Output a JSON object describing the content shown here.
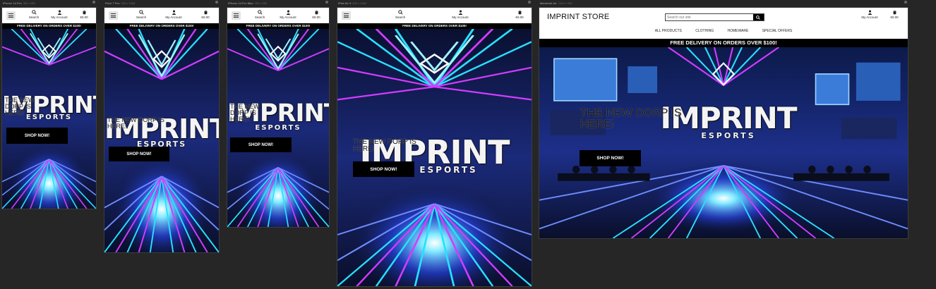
{
  "devices": [
    {
      "name": "iPhone 14 Pro",
      "dims": "390 x 852"
    },
    {
      "name": "Pixel 7 Pro",
      "dims": "430 x 1008"
    },
    {
      "name": "iPhone 14 Pro Max",
      "dims": "430 x 932"
    },
    {
      "name": "iPad Air 5",
      "dims": "820 x 1180"
    },
    {
      "name": "Macbook Air",
      "dims": "1440 x 900"
    }
  ],
  "store": {
    "brand": "IMPRINT STORE",
    "search_label": "Search",
    "search_placeholder": "Search our site",
    "account_label": "My Account",
    "cart_total": "€0.00",
    "delivery_banner": "FREE DELIVERY ON ORDERS OVER $100!",
    "nav": [
      "ALL PRODUCTS",
      "CLOTHING",
      "HOMEWARE",
      "SPECIAL OFFERS"
    ]
  },
  "hero": {
    "logo_main": "IMPRINT",
    "logo_sub": "ESPORTS",
    "tagline": "THE NEW DORP IS HERE!",
    "cta": "SHOP NOW!"
  },
  "colors": {
    "cyan": "#28e0ff",
    "magenta": "#d23cff",
    "blue": "#2a4bff",
    "dark": "#0c0f2e"
  }
}
